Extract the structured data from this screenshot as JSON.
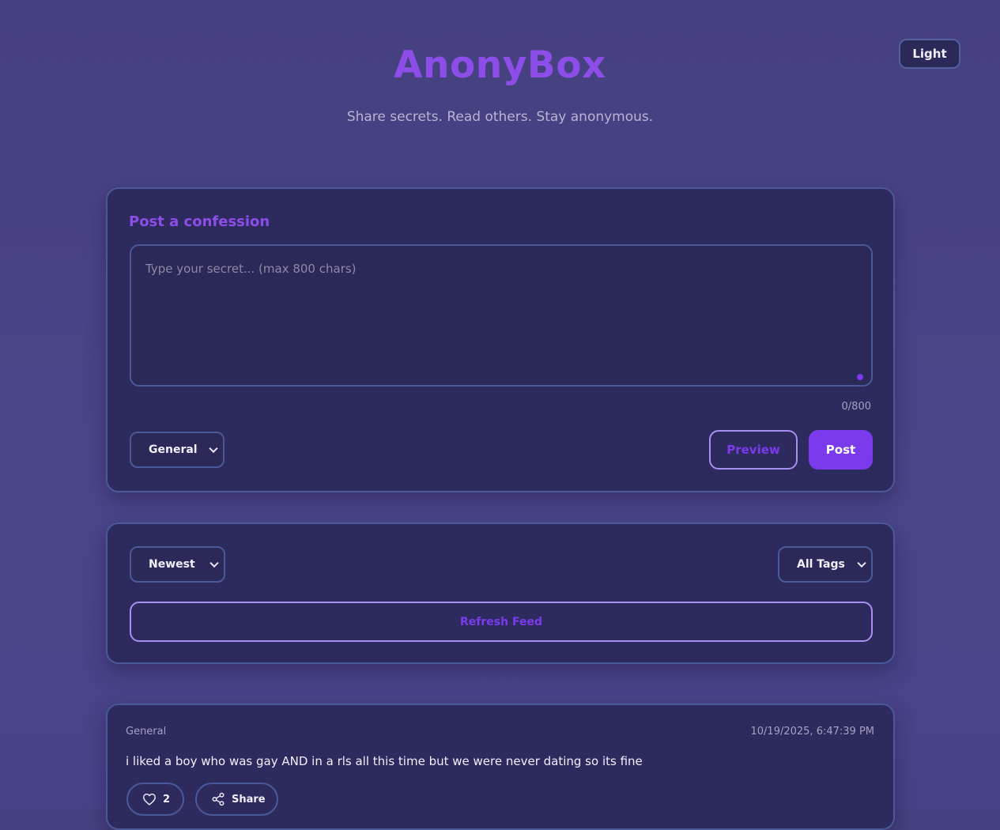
{
  "app": {
    "title": "AnonyBox",
    "subtitle": "Share secrets. Read others. Stay anonymous.",
    "theme_toggle": "Light"
  },
  "compose": {
    "heading": "Post a confession",
    "placeholder": "Type your secret... (max 800 chars)",
    "counter": "0/800",
    "category_selected": "General",
    "preview_label": "Preview",
    "post_label": "Post"
  },
  "feed_controls": {
    "sort_selected": "Newest",
    "tag_selected": "All Tags",
    "refresh_label": "Refresh Feed"
  },
  "entries": [
    {
      "tag": "General",
      "timestamp": "10/19/2025, 6:47:39 PM",
      "text": "i liked a boy who was gay AND in a rls all this time but we were never dating so its fine",
      "likes": "2",
      "share_label": "Share"
    }
  ],
  "colors": {
    "accent": "#7c3aed",
    "title": "#8d4de8",
    "card_bg": "#2d2b5e",
    "border": "#4b5899"
  },
  "icons": {
    "like": "heart-icon",
    "share": "share-icon",
    "dropdown": "chevron-down-icon"
  }
}
